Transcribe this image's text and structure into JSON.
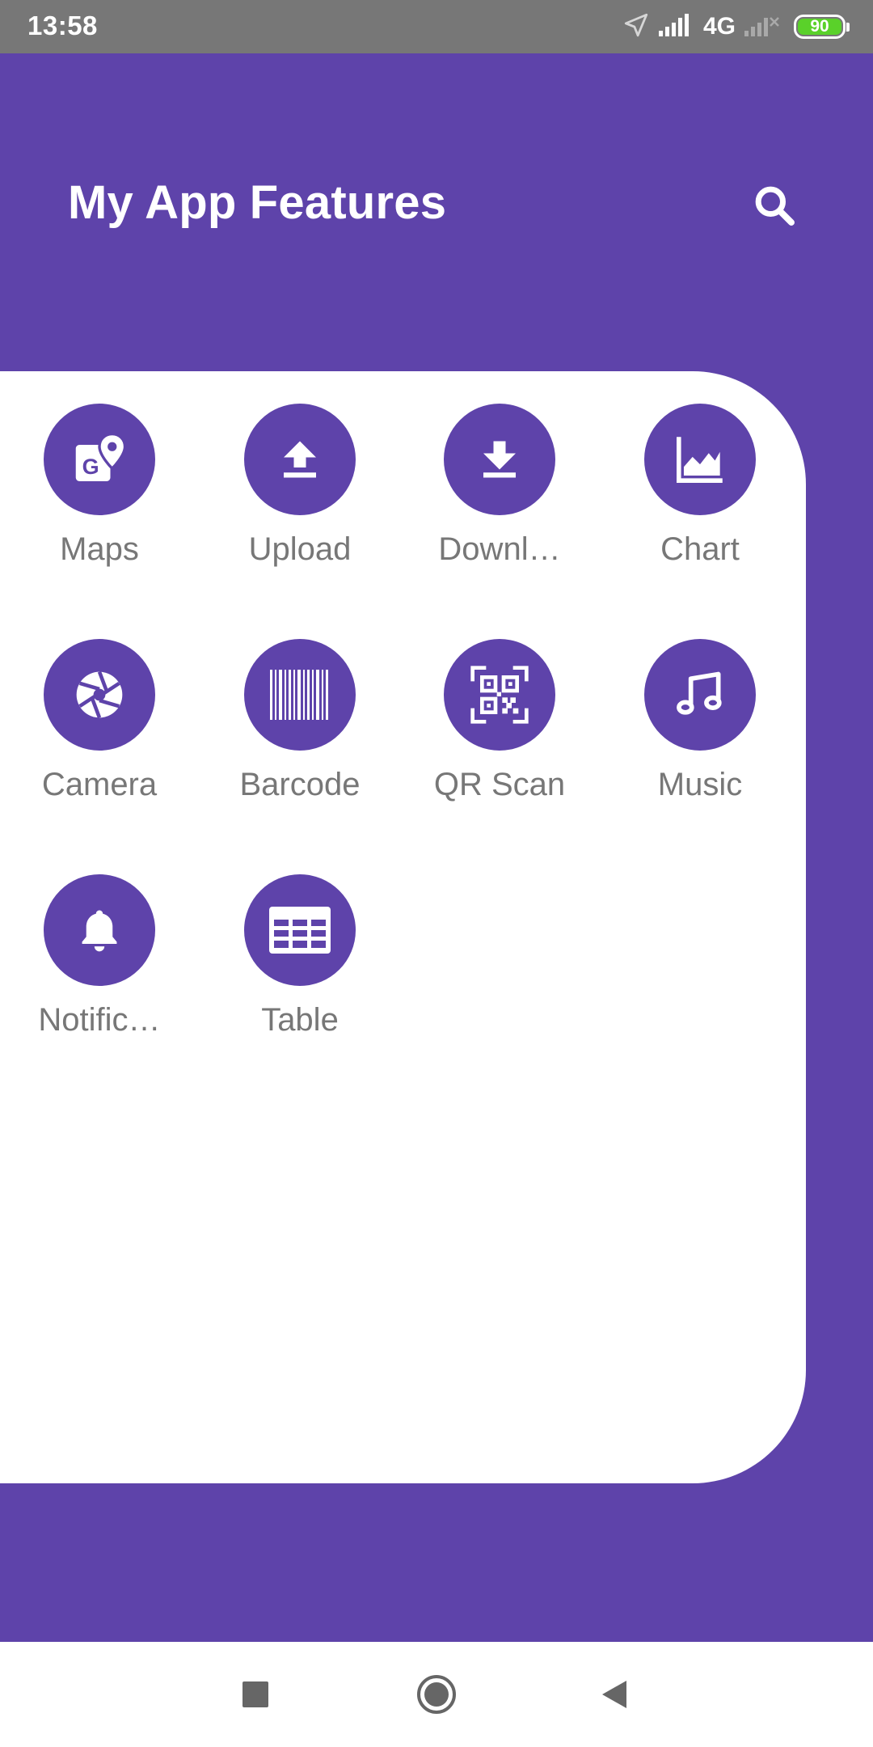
{
  "status_bar": {
    "time": "13:58",
    "network": "4G",
    "battery": "90",
    "icons": [
      "location-icon",
      "signal-icon",
      "signal-off-icon",
      "battery-icon"
    ]
  },
  "header": {
    "title": "My App Features",
    "search_icon": "search-icon"
  },
  "features": [
    {
      "label": "Maps",
      "icon": "maps-icon"
    },
    {
      "label": "Upload",
      "icon": "upload-icon"
    },
    {
      "label": "Downl…",
      "icon": "download-icon"
    },
    {
      "label": "Chart",
      "icon": "chart-icon"
    },
    {
      "label": "Camera",
      "icon": "camera-icon"
    },
    {
      "label": "Barcode",
      "icon": "barcode-icon"
    },
    {
      "label": "QR Scan",
      "icon": "qr-scan-icon"
    },
    {
      "label": "Music",
      "icon": "music-icon"
    },
    {
      "label": "Notific…",
      "icon": "notification-icon"
    },
    {
      "label": "Table",
      "icon": "table-icon"
    }
  ],
  "nav_bar": {
    "icons": [
      "recents-icon",
      "home-icon",
      "back-icon"
    ]
  },
  "colors": {
    "primary": "#5e43aa",
    "status_bar": "#777777",
    "label": "#777777",
    "battery": "#5ad12a",
    "surface": "#ffffff"
  }
}
